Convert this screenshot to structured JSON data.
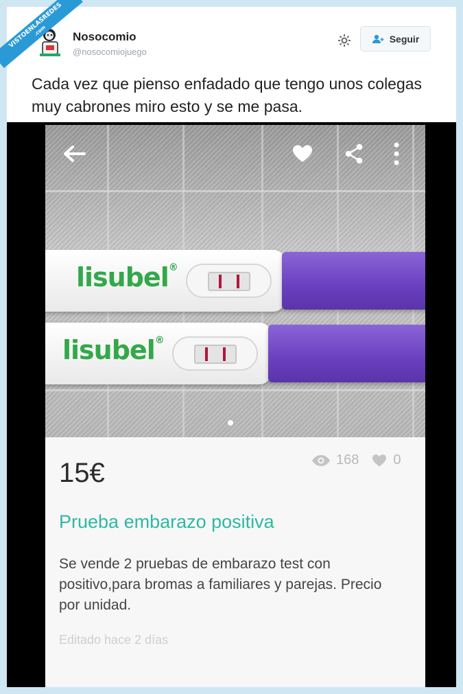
{
  "watermark": {
    "line1": "VISTOENLASREDES",
    "line2": ".com"
  },
  "tweet": {
    "user_name": "Nosocomio",
    "user_handle": "@nosocomiojuego",
    "follow_label": "Seguir",
    "text": "Cada vez que pienso enfadado que tengo unos colegas muy cabrones miro esto y se me pasa."
  },
  "listing": {
    "brand": "lisubel",
    "brand_mark": "®",
    "price": "15€",
    "views": "168",
    "likes": "0",
    "title": "Prueba embarazo positiva",
    "description": "Se vende 2 pruebas de embarazo test  con positivo,para bromas a familiares y parejas. Precio por unidad.",
    "edited": "Editado hace 2 días"
  },
  "colors": {
    "accent": "#2eb8a3",
    "brand_green": "#33a84a",
    "cap_purple": "#6a3fc0",
    "twitter_blue": "#2a9ad6"
  },
  "icons": [
    "back-arrow-icon",
    "heart-icon",
    "share-icon",
    "more-vertical-icon",
    "gear-icon",
    "add-user-icon",
    "eye-icon"
  ]
}
